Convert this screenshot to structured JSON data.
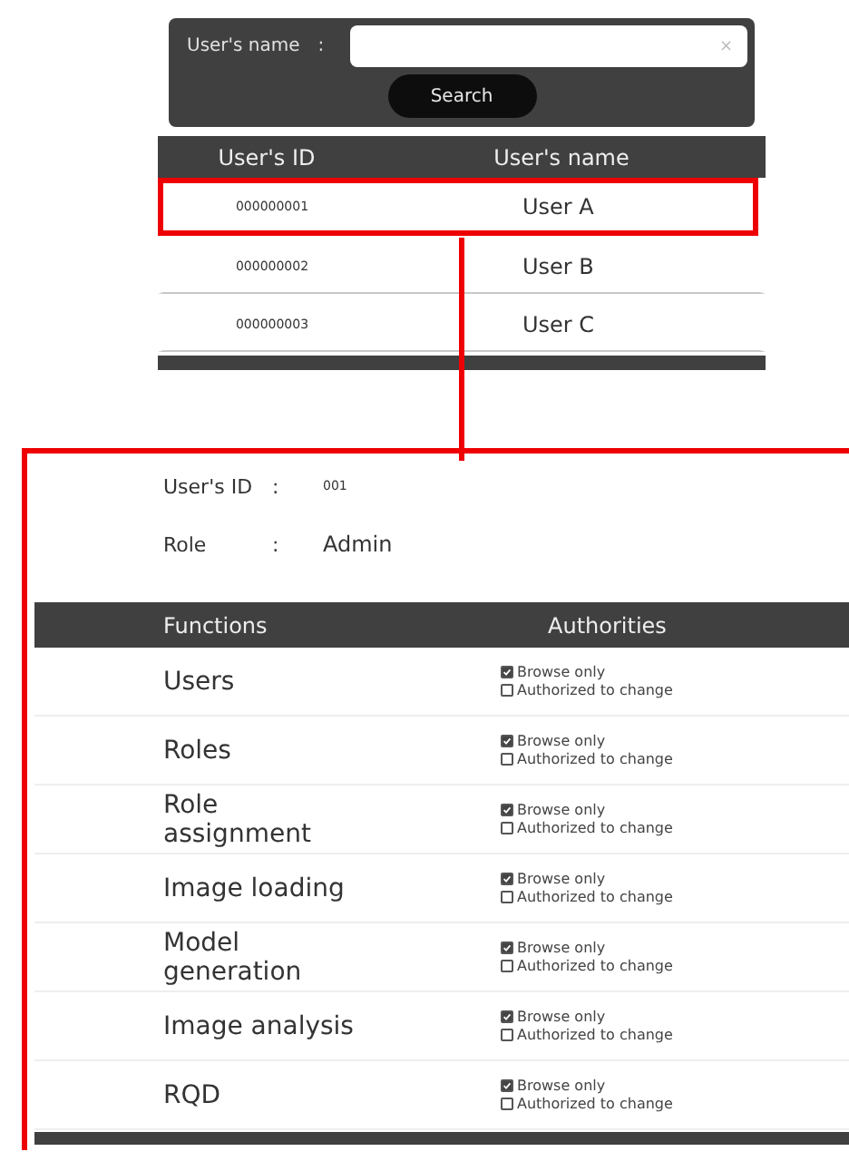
{
  "search": {
    "label": "User's name",
    "colon": ":",
    "clear": "×",
    "button": "Search"
  },
  "users_table": {
    "columns": [
      "User's ID",
      "User's name"
    ],
    "rows": [
      {
        "id": "000000001",
        "name": "User A",
        "selected": true
      },
      {
        "id": "000000002",
        "name": "User B",
        "selected": false
      },
      {
        "id": "000000003",
        "name": "User C",
        "selected": false
      }
    ]
  },
  "detail": {
    "fields": [
      {
        "kind": "code",
        "label": "User's ID",
        "colon": ":",
        "value": "001"
      },
      {
        "kind": "text",
        "label": "Role",
        "colon": ":",
        "value": "Admin"
      }
    ],
    "columns": [
      "Functions",
      "Authorities"
    ],
    "rows": [
      {
        "function": "Users",
        "options": [
          {
            "label": "Browse only",
            "checked": true
          },
          {
            "label": "Authorized to change",
            "checked": false
          }
        ]
      },
      {
        "function": "Roles",
        "options": [
          {
            "label": "Browse only",
            "checked": true
          },
          {
            "label": "Authorized to change",
            "checked": false
          }
        ]
      },
      {
        "function": "Role assignment",
        "options": [
          {
            "label": "Browse only",
            "checked": true
          },
          {
            "label": "Authorized to change",
            "checked": false
          }
        ]
      },
      {
        "function": "Image loading",
        "options": [
          {
            "label": "Browse only",
            "checked": true
          },
          {
            "label": "Authorized to change",
            "checked": false
          }
        ]
      },
      {
        "function": "Model generation",
        "options": [
          {
            "label": "Browse only",
            "checked": true
          },
          {
            "label": "Authorized to change",
            "checked": false
          }
        ]
      },
      {
        "function": "Image analysis",
        "options": [
          {
            "label": "Browse only",
            "checked": true
          },
          {
            "label": "Authorized to change",
            "checked": false
          }
        ]
      },
      {
        "function": "RQD",
        "options": [
          {
            "label": "Browse only",
            "checked": true
          },
          {
            "label": "Authorized to change",
            "checked": false
          }
        ]
      }
    ]
  }
}
